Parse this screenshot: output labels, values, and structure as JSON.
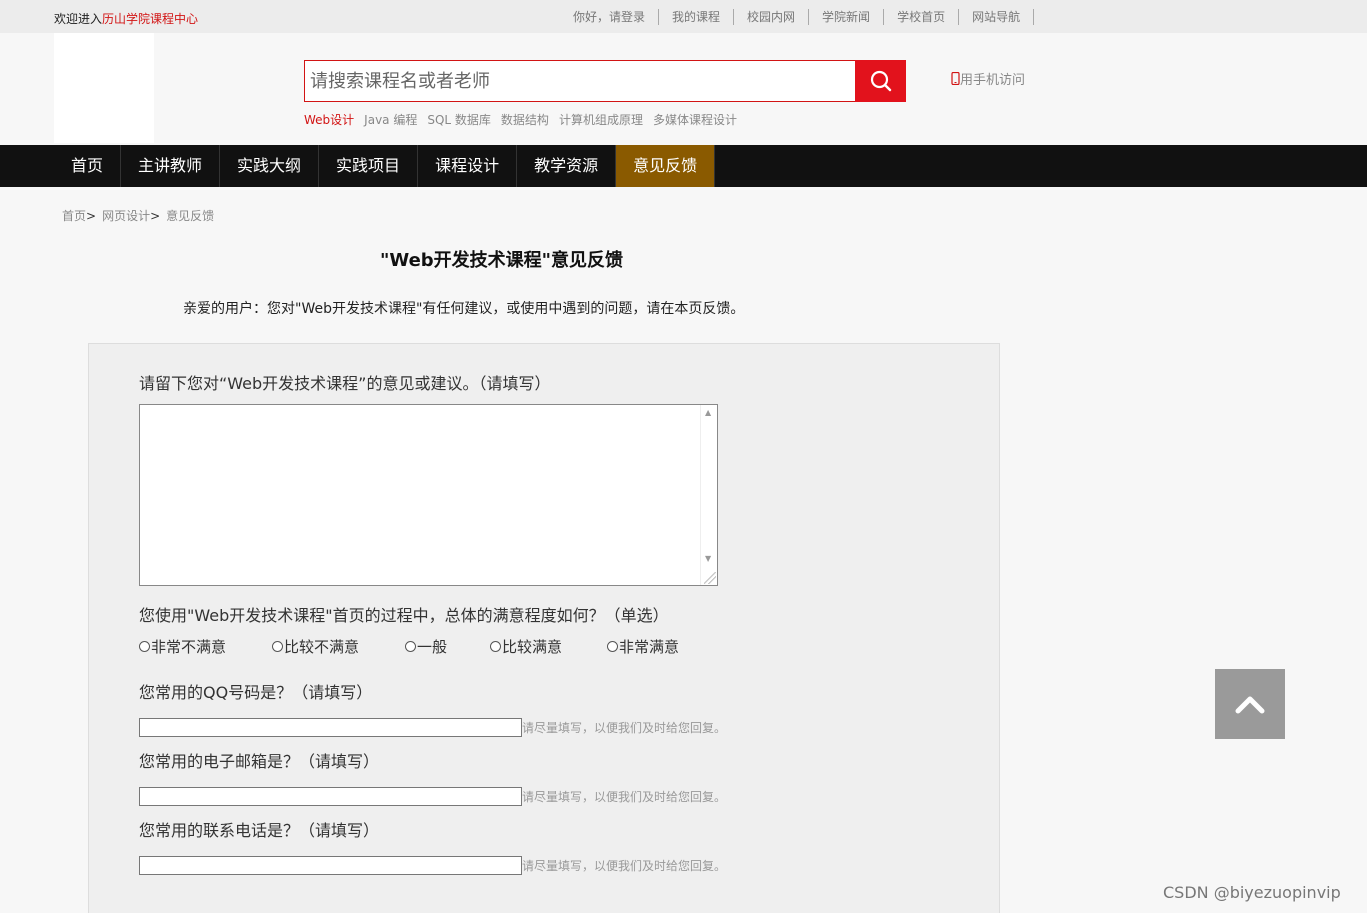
{
  "topbar": {
    "welcome_prefix": "欢迎进入",
    "welcome_site": "历山学院课程中心",
    "links": [
      "你好，请登录",
      "我的课程",
      "校园内网",
      "学院新闻",
      "学校首页",
      "网站导航"
    ]
  },
  "header": {
    "search_placeholder": "请搜索课程名或者老师",
    "hot_keywords": [
      "Web设计",
      "Java 编程",
      "SQL 数据库",
      "数据结构",
      "计算机组成原理",
      "多媒体课程设计"
    ],
    "mobile_label": "用手机访问"
  },
  "nav": {
    "items": [
      "首页",
      "主讲教师",
      "实践大纲",
      "实践项目",
      "课程设计",
      "教学资源",
      "意见反馈"
    ],
    "active_index": 6
  },
  "breadcrumb": [
    "首页",
    "网页设计",
    "意见反馈"
  ],
  "page": {
    "title": "\"Web开发技术课程\"意见反馈",
    "intro": "亲爱的用户：您对\"Web开发技术课程\"有任何建议，或使用中遇到的问题，请在本页反馈。"
  },
  "form": {
    "q1": "请留下您对“Web开发技术课程”的意见或建议。（请填写）",
    "q2": "您使用\"Web开发技术课程\"首页的过程中，总体的满意程度如何？（单选）",
    "options": [
      "非常不满意",
      "比较不满意",
      "一般",
      "比较满意",
      "非常满意"
    ],
    "q3": "您常用的QQ号码是？（请填写）",
    "q4": "您常用的电子邮箱是？（请填写）",
    "q5": "您常用的联系电话是？（请填写）",
    "hint": "请尽量填写，以便我们及时给您回复。"
  },
  "watermark": "CSDN @biyezuopinvip",
  "colors": {
    "accent": "#e2121c",
    "nav_active": "#8a5a00"
  }
}
